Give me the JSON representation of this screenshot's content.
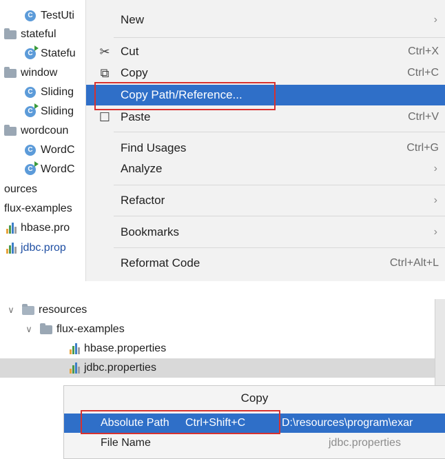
{
  "top_tree": {
    "items": [
      {
        "label": "TestUti",
        "kind": "class",
        "runnable": false
      },
      {
        "label": "stateful",
        "kind": "folder"
      },
      {
        "label": "Statefu",
        "kind": "class",
        "runnable": true
      },
      {
        "label": "window",
        "kind": "folder"
      },
      {
        "label": "Sliding",
        "kind": "class",
        "runnable": false
      },
      {
        "label": "Sliding",
        "kind": "class",
        "runnable": true
      },
      {
        "label": "wordcoun",
        "kind": "folder"
      },
      {
        "label": "WordC",
        "kind": "class",
        "runnable": false
      },
      {
        "label": "WordC",
        "kind": "class",
        "runnable": true
      },
      {
        "label": "ources",
        "kind": "text"
      },
      {
        "label": "flux-examples",
        "kind": "text"
      },
      {
        "label": "hbase.pro",
        "kind": "properties"
      },
      {
        "label": "jdbc.prop",
        "kind": "properties"
      }
    ]
  },
  "context_menu": {
    "items": [
      {
        "label": "New",
        "shortcut": "",
        "submenu": true,
        "icon": ""
      },
      {
        "label": "Cut",
        "shortcut": "Ctrl+X",
        "submenu": false,
        "icon": "scissors-icon"
      },
      {
        "label": "Copy",
        "shortcut": "Ctrl+C",
        "submenu": false,
        "icon": "copy-icon"
      },
      {
        "label": "Copy Path/Reference...",
        "shortcut": "",
        "submenu": false,
        "icon": "",
        "selected": true
      },
      {
        "label": "Paste",
        "shortcut": "Ctrl+V",
        "submenu": false,
        "icon": "clipboard-icon"
      },
      {
        "label": "Find Usages",
        "shortcut": "Ctrl+G",
        "submenu": false,
        "icon": ""
      },
      {
        "label": "Analyze",
        "shortcut": "",
        "submenu": true,
        "icon": ""
      },
      {
        "label": "Refactor",
        "shortcut": "",
        "submenu": true,
        "icon": ""
      },
      {
        "label": "Bookmarks",
        "shortcut": "",
        "submenu": true,
        "icon": ""
      },
      {
        "label": "Reformat Code",
        "shortcut": "Ctrl+Alt+L",
        "submenu": false,
        "icon": ""
      }
    ],
    "arrow_glyph": "›"
  },
  "bottom_tree": {
    "resources": "resources",
    "flux_examples": "flux-examples",
    "hbase": "hbase.properties",
    "jdbc": "jdbc.properties"
  },
  "copy_popup": {
    "title": "Copy",
    "rows": [
      {
        "label": "Absolute Path",
        "shortcut": "Ctrl+Shift+C",
        "value": "D:\\resources\\program\\exar",
        "selected": true
      },
      {
        "label": "File Name",
        "shortcut": "",
        "value": "jdbc.properties",
        "selected": false
      }
    ]
  },
  "colors": {
    "selection": "#2f6fc8",
    "highlight_box": "#d7312e",
    "menu_bg": "#f2f2f2"
  }
}
